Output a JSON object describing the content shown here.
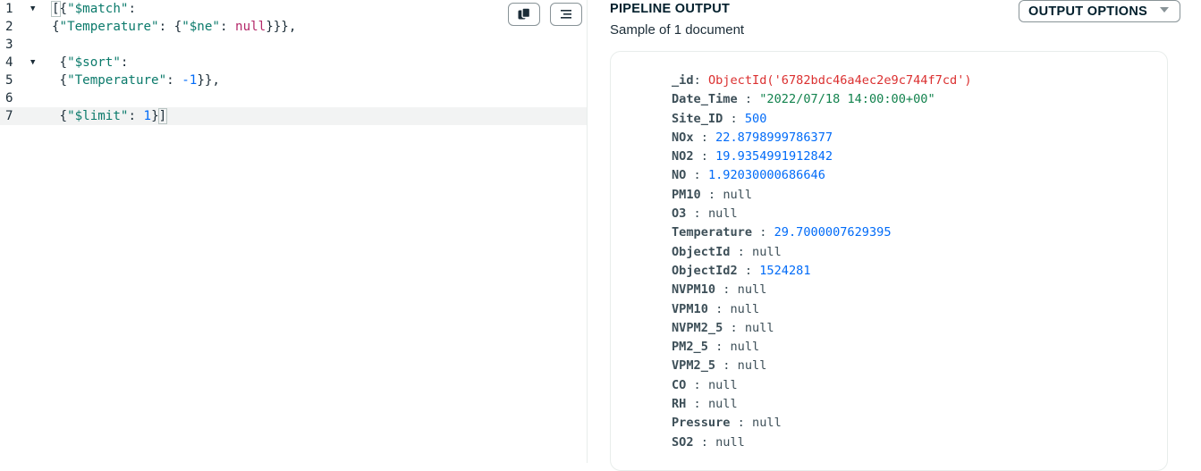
{
  "editor": {
    "lines": [
      {
        "num": "1",
        "foldable": true,
        "tokens": [
          {
            "t": "[",
            "c": "t-punc bracket-box"
          },
          {
            "t": "{",
            "c": "t-punc"
          },
          {
            "t": "\"$match\"",
            "c": "t-key"
          },
          {
            "t": ":",
            "c": "t-punc"
          }
        ]
      },
      {
        "num": "2",
        "foldable": false,
        "tokens": [
          {
            "t": "{",
            "c": "t-punc"
          },
          {
            "t": "\"Temperature\"",
            "c": "t-key"
          },
          {
            "t": ": {",
            "c": "t-punc"
          },
          {
            "t": "\"$ne\"",
            "c": "t-key"
          },
          {
            "t": ": ",
            "c": "t-punc"
          },
          {
            "t": "null",
            "c": "t-null"
          },
          {
            "t": "}}},",
            "c": "t-punc"
          }
        ]
      },
      {
        "num": "3",
        "foldable": false,
        "tokens": []
      },
      {
        "num": "4",
        "foldable": true,
        "tokens": [
          {
            "t": " {",
            "c": "t-punc"
          },
          {
            "t": "\"$sort\"",
            "c": "t-key"
          },
          {
            "t": ":",
            "c": "t-punc"
          }
        ]
      },
      {
        "num": "5",
        "foldable": false,
        "tokens": [
          {
            "t": " {",
            "c": "t-punc"
          },
          {
            "t": "\"Temperature\"",
            "c": "t-key"
          },
          {
            "t": ": ",
            "c": "t-punc"
          },
          {
            "t": "-1",
            "c": "t-num"
          },
          {
            "t": "}},",
            "c": "t-punc"
          }
        ]
      },
      {
        "num": "6",
        "foldable": false,
        "tokens": []
      },
      {
        "num": "7",
        "foldable": false,
        "active": true,
        "tokens": [
          {
            "t": " {",
            "c": "t-punc"
          },
          {
            "t": "\"$limit\"",
            "c": "t-key"
          },
          {
            "t": ": ",
            "c": "t-punc"
          },
          {
            "t": "1",
            "c": "t-num"
          },
          {
            "t": "}",
            "c": "t-punc"
          },
          {
            "t": "]",
            "c": "t-punc bracket-box"
          }
        ]
      }
    ],
    "copy_icon": "copy-icon",
    "format_icon": "format-icon"
  },
  "output": {
    "title": "PIPELINE OUTPUT",
    "subtitle": "Sample of 1 document",
    "options_label": "OUTPUT OPTIONS",
    "fields": [
      {
        "key": "_id",
        "sep": ": ",
        "value": "ObjectId('6782bdc46a4ec2e9c744f7cd')",
        "type": "v-objectid"
      },
      {
        "key": "Date_Time",
        "sep": " : ",
        "value": "\"2022/07/18 14:00:00+00\"",
        "type": "v-string"
      },
      {
        "key": "Site_ID",
        "sep": " : ",
        "value": "500",
        "type": "v-number"
      },
      {
        "key": "NOx",
        "sep": " : ",
        "value": "22.8798999786377",
        "type": "v-number"
      },
      {
        "key": "NO2",
        "sep": " : ",
        "value": "19.9354991912842",
        "type": "v-number"
      },
      {
        "key": "NO",
        "sep": " : ",
        "value": "1.92030000686646",
        "type": "v-number"
      },
      {
        "key": "PM10",
        "sep": " : ",
        "value": "null",
        "type": "v-null"
      },
      {
        "key": "O3",
        "sep": " : ",
        "value": "null",
        "type": "v-null"
      },
      {
        "key": "Temperature",
        "sep": " : ",
        "value": "29.7000007629395",
        "type": "v-number"
      },
      {
        "key": "ObjectId",
        "sep": " : ",
        "value": "null",
        "type": "v-null"
      },
      {
        "key": "ObjectId2",
        "sep": " : ",
        "value": "1524281",
        "type": "v-number"
      },
      {
        "key": "NVPM10",
        "sep": " : ",
        "value": "null",
        "type": "v-null"
      },
      {
        "key": "VPM10",
        "sep": " : ",
        "value": "null",
        "type": "v-null"
      },
      {
        "key": "NVPM2_5",
        "sep": " : ",
        "value": "null",
        "type": "v-null"
      },
      {
        "key": "PM2_5",
        "sep": " : ",
        "value": "null",
        "type": "v-null"
      },
      {
        "key": "VPM2_5",
        "sep": " : ",
        "value": "null",
        "type": "v-null"
      },
      {
        "key": "CO",
        "sep": " : ",
        "value": "null",
        "type": "v-null"
      },
      {
        "key": "RH",
        "sep": " : ",
        "value": "null",
        "type": "v-null"
      },
      {
        "key": "Pressure",
        "sep": " : ",
        "value": "null",
        "type": "v-null"
      },
      {
        "key": "SO2",
        "sep": " : ",
        "value": "null",
        "type": "v-null"
      }
    ]
  },
  "colors": {
    "key_green": "#0b7a6b",
    "null_pink": "#b4296a",
    "number_blue": "#016bf8",
    "objectid_red": "#db3030",
    "string_green": "#12824d"
  }
}
